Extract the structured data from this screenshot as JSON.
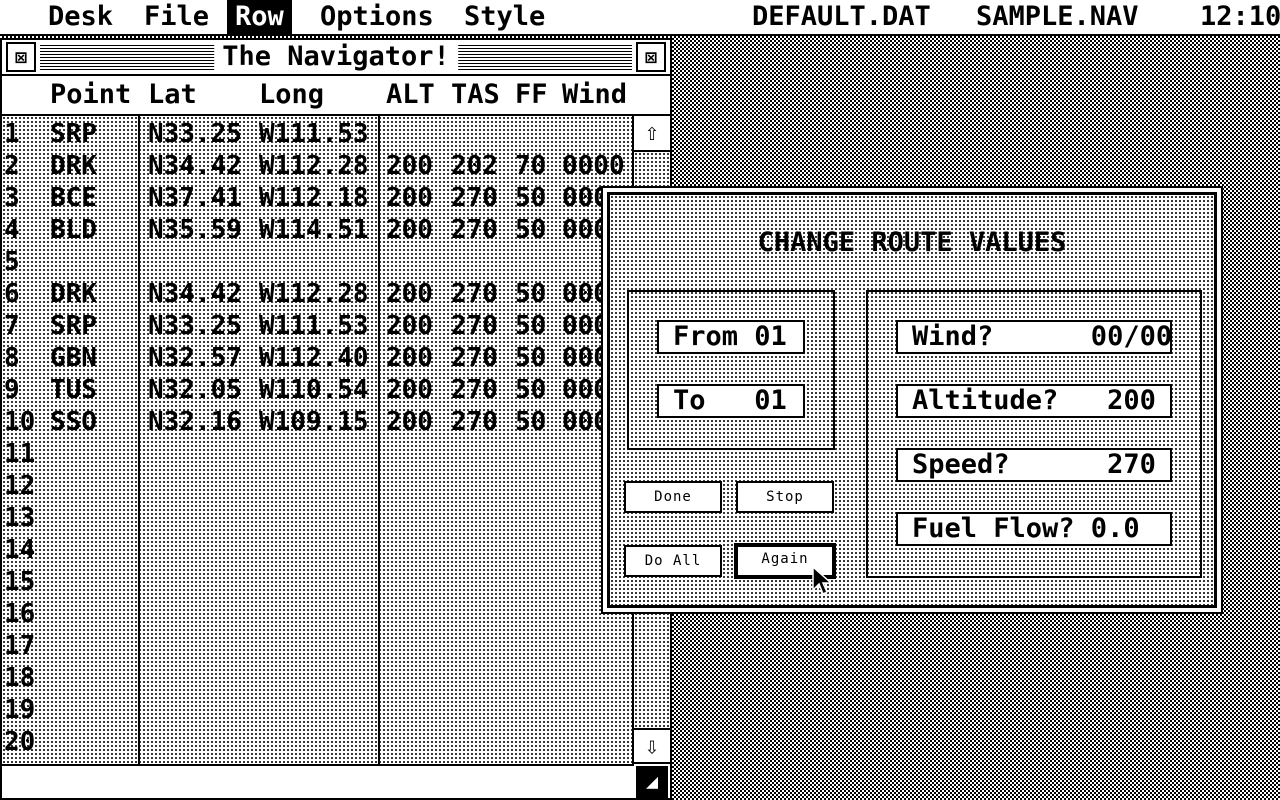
{
  "menubar": {
    "items": [
      "Desk",
      "File",
      "Row",
      "Options",
      "Style"
    ],
    "active": "Row",
    "data_file": "DEFAULT.DAT",
    "nav_file": "SAMPLE.NAV",
    "clock": "12:10"
  },
  "window": {
    "title": "The Navigator!",
    "close_icon": "close-icon",
    "fuller_icon": "fuller-icon",
    "columns": [
      "Point",
      "Lat",
      "Long",
      "ALT",
      "TAS",
      "FF",
      "Wind"
    ],
    "rows": [
      {
        "num": "1",
        "point": "SRP",
        "lat": "N33.25",
        "long": "W111.53",
        "alt": "",
        "tas": "",
        "ff": "",
        "wind": ""
      },
      {
        "num": "2",
        "point": "DRK",
        "lat": "N34.42",
        "long": "W112.28",
        "alt": "200",
        "tas": "202",
        "ff": "70",
        "wind": "0000"
      },
      {
        "num": "3",
        "point": "BCE",
        "lat": "N37.41",
        "long": "W112.18",
        "alt": "200",
        "tas": "270",
        "ff": "50",
        "wind": "000"
      },
      {
        "num": "4",
        "point": "BLD",
        "lat": "N35.59",
        "long": "W114.51",
        "alt": "200",
        "tas": "270",
        "ff": "50",
        "wind": "000"
      },
      {
        "num": "5",
        "point": "",
        "lat": "",
        "long": "",
        "alt": "",
        "tas": "",
        "ff": "",
        "wind": ""
      },
      {
        "num": "6",
        "point": "DRK",
        "lat": "N34.42",
        "long": "W112.28",
        "alt": "200",
        "tas": "270",
        "ff": "50",
        "wind": "000"
      },
      {
        "num": "7",
        "point": "SRP",
        "lat": "N33.25",
        "long": "W111.53",
        "alt": "200",
        "tas": "270",
        "ff": "50",
        "wind": "000"
      },
      {
        "num": "8",
        "point": "GBN",
        "lat": "N32.57",
        "long": "W112.40",
        "alt": "200",
        "tas": "270",
        "ff": "50",
        "wind": "000"
      },
      {
        "num": "9",
        "point": "TUS",
        "lat": "N32.05",
        "long": "W110.54",
        "alt": "200",
        "tas": "270",
        "ff": "50",
        "wind": "000"
      },
      {
        "num": "10",
        "point": "SSO",
        "lat": "N32.16",
        "long": "W109.15",
        "alt": "200",
        "tas": "270",
        "ff": "50",
        "wind": "000"
      },
      {
        "num": "11",
        "point": "",
        "lat": "",
        "long": "",
        "alt": "",
        "tas": "",
        "ff": "",
        "wind": ""
      },
      {
        "num": "12",
        "point": "",
        "lat": "",
        "long": "",
        "alt": "",
        "tas": "",
        "ff": "",
        "wind": ""
      },
      {
        "num": "13",
        "point": "",
        "lat": "",
        "long": "",
        "alt": "",
        "tas": "",
        "ff": "",
        "wind": ""
      },
      {
        "num": "14",
        "point": "",
        "lat": "",
        "long": "",
        "alt": "",
        "tas": "",
        "ff": "",
        "wind": ""
      },
      {
        "num": "15",
        "point": "",
        "lat": "",
        "long": "",
        "alt": "",
        "tas": "",
        "ff": "",
        "wind": ""
      },
      {
        "num": "16",
        "point": "",
        "lat": "",
        "long": "",
        "alt": "",
        "tas": "",
        "ff": "",
        "wind": ""
      },
      {
        "num": "17",
        "point": "",
        "lat": "",
        "long": "",
        "alt": "",
        "tas": "",
        "ff": "",
        "wind": ""
      },
      {
        "num": "18",
        "point": "",
        "lat": "",
        "long": "",
        "alt": "",
        "tas": "",
        "ff": "",
        "wind": ""
      },
      {
        "num": "19",
        "point": "",
        "lat": "",
        "long": "",
        "alt": "",
        "tas": "",
        "ff": "",
        "wind": ""
      },
      {
        "num": "20",
        "point": "",
        "lat": "",
        "long": "",
        "alt": "",
        "tas": "",
        "ff": "",
        "wind": ""
      }
    ],
    "scroll_up_icon": "⇧",
    "scroll_down_icon": "⇩"
  },
  "dialog": {
    "title": "CHANGE ROUTE VALUES",
    "from_field": "From 01",
    "to_field": "To   01",
    "wind_field": "Wind?      00/00",
    "altitude_field": "Altitude?   200",
    "speed_field": "Speed?      270",
    "fuel_flow_field": "Fuel Flow? 0.0",
    "buttons": {
      "done": "Done",
      "stop": "Stop",
      "do_all": "Do All",
      "again": "Again"
    }
  }
}
